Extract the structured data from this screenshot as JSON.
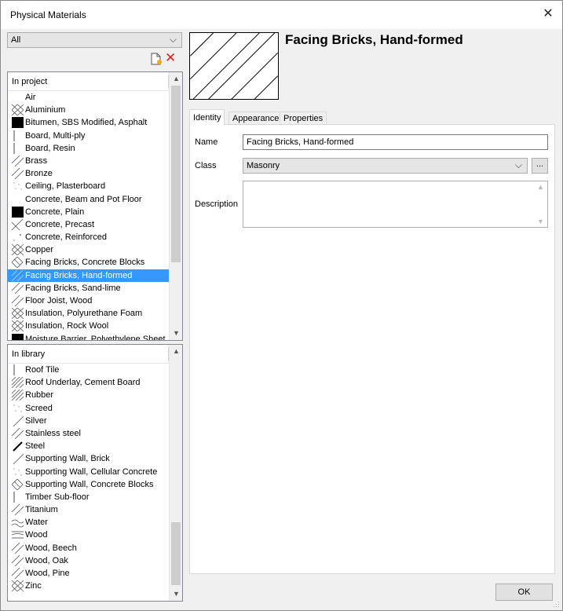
{
  "window": {
    "title": "Physical Materials"
  },
  "filter": {
    "value": "All"
  },
  "project_list": {
    "header": "In project",
    "items": [
      {
        "label": "Air",
        "icon": "none"
      },
      {
        "label": "Aluminium",
        "icon": "crosshatch-diamond"
      },
      {
        "label": "Bitumen, SBS Modified, Asphalt",
        "icon": "solid-black"
      },
      {
        "label": "Board, Multi-ply",
        "icon": "vertical-line"
      },
      {
        "label": "Board, Resin",
        "icon": "vertical-line"
      },
      {
        "label": "Brass",
        "icon": "diagonal-light"
      },
      {
        "label": "Bronze",
        "icon": "diagonal-light"
      },
      {
        "label": "Ceiling, Plasterboard",
        "icon": "dots"
      },
      {
        "label": "Concrete, Beam and Pot Floor",
        "icon": "none"
      },
      {
        "label": "Concrete, Plain",
        "icon": "solid-black"
      },
      {
        "label": "Concrete, Precast",
        "icon": "crosshatch-light"
      },
      {
        "label": "Concrete, Reinforced",
        "icon": "dots-sparse"
      },
      {
        "label": "Copper",
        "icon": "crosshatch-diamond"
      },
      {
        "label": "Facing Bricks, Concrete Blocks",
        "icon": "diamond-brick"
      },
      {
        "label": "Facing Bricks, Hand-formed",
        "icon": "diagonal",
        "selected": true
      },
      {
        "label": "Facing Bricks, Sand-lime",
        "icon": "diagonal-light"
      },
      {
        "label": "Floor Joist, Wood",
        "icon": "diagonal-light"
      },
      {
        "label": "Insulation, Polyurethane Foam",
        "icon": "crosshatch-diamond"
      },
      {
        "label": "Insulation, Rock Wool",
        "icon": "crosshatch-diamond"
      },
      {
        "label": "Moisture Barrier, Polyethylene Sheet",
        "icon": "solid-black"
      }
    ]
  },
  "library_list": {
    "header": "In library",
    "items": [
      {
        "label": "Roof Tile",
        "icon": "vertical-line"
      },
      {
        "label": "Roof Underlay, Cement Board",
        "icon": "diagonal-dense"
      },
      {
        "label": "Rubber",
        "icon": "diagonal-dense"
      },
      {
        "label": "Screed",
        "icon": "dots"
      },
      {
        "label": "Silver",
        "icon": "diagonal-single"
      },
      {
        "label": "Stainless steel",
        "icon": "diagonal-light"
      },
      {
        "label": "Steel",
        "icon": "diagonal-bold"
      },
      {
        "label": "Supporting Wall, Brick",
        "icon": "diagonal-single"
      },
      {
        "label": "Supporting Wall, Cellular Concrete",
        "icon": "dots"
      },
      {
        "label": "Supporting Wall, Concrete Blocks",
        "icon": "diamond-brick"
      },
      {
        "label": "Timber Sub-floor",
        "icon": "vertical-line"
      },
      {
        "label": "Titanium",
        "icon": "diagonal-light"
      },
      {
        "label": "Water",
        "icon": "waves"
      },
      {
        "label": "Wood",
        "icon": "wood-grain"
      },
      {
        "label": "Wood, Beech",
        "icon": "diagonal-light"
      },
      {
        "label": "Wood, Oak",
        "icon": "diagonal-light"
      },
      {
        "label": "Wood, Pine",
        "icon": "diagonal-light"
      },
      {
        "label": "Zinc",
        "icon": "crosshatch-diamond"
      }
    ]
  },
  "detail": {
    "title": "Facing Bricks, Hand-formed",
    "tabs": [
      "Identity",
      "Appearance",
      "Properties"
    ],
    "active_tab": "Identity",
    "name_label": "Name",
    "name_value": "Facing Bricks, Hand-formed",
    "class_label": "Class",
    "class_value": "Masonry",
    "class_more": "...",
    "description_label": "Description",
    "description_value": ""
  },
  "buttons": {
    "ok": "OK"
  },
  "colors": {
    "selection": "#3399ff",
    "delete": "#e02020"
  }
}
